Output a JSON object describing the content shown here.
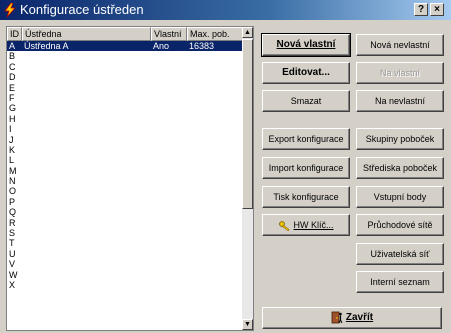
{
  "window": {
    "title": "Konfigurace ústředen",
    "help_label": "?",
    "close_label": "×"
  },
  "table": {
    "columns": [
      "ID",
      "Ústředna",
      "Vlastní",
      "Max. pob."
    ],
    "rows": [
      {
        "id": "A",
        "name": "Ústředna A",
        "own": "Ano",
        "max": "16383",
        "selected": true
      },
      {
        "id": "B"
      },
      {
        "id": "C"
      },
      {
        "id": "D"
      },
      {
        "id": "E"
      },
      {
        "id": "F"
      },
      {
        "id": "G"
      },
      {
        "id": "H"
      },
      {
        "id": "I"
      },
      {
        "id": "J"
      },
      {
        "id": "K"
      },
      {
        "id": "L"
      },
      {
        "id": "M"
      },
      {
        "id": "N"
      },
      {
        "id": "O"
      },
      {
        "id": "P"
      },
      {
        "id": "Q"
      },
      {
        "id": "R"
      },
      {
        "id": "S"
      },
      {
        "id": "T"
      },
      {
        "id": "U"
      },
      {
        "id": "V"
      },
      {
        "id": "W"
      },
      {
        "id": "X"
      }
    ]
  },
  "scrollbar": {
    "up": "▲",
    "down": "▼"
  },
  "buttons": {
    "new_own": "Nová vlastní",
    "new_foreign": "Nová nevlastní",
    "edit": "Editovat...",
    "own": "Na vlastní",
    "delete": "Smazat",
    "foreign": "Na nevlastní",
    "export": "Export konfigurace",
    "import": "Import konfigurace",
    "print": "Tisk konfigurace",
    "hw_key": "HW Klíč...",
    "branch_groups": "Skupiny poboček",
    "branch_centers": "Střediska poboček",
    "input_points": "Vstupní body",
    "transit_networks": "Průchodové sítě",
    "user_network": "Uživatelská síť",
    "internal_list": "Interní seznam",
    "close": "Zavřít"
  },
  "colors": {
    "titlebar": "#0a246a",
    "selection": "#0a246a",
    "face": "#d4d0c8"
  },
  "icons": {
    "title": "lightning-icon",
    "hw_key": "key-icon",
    "close": "door-exit-icon"
  }
}
